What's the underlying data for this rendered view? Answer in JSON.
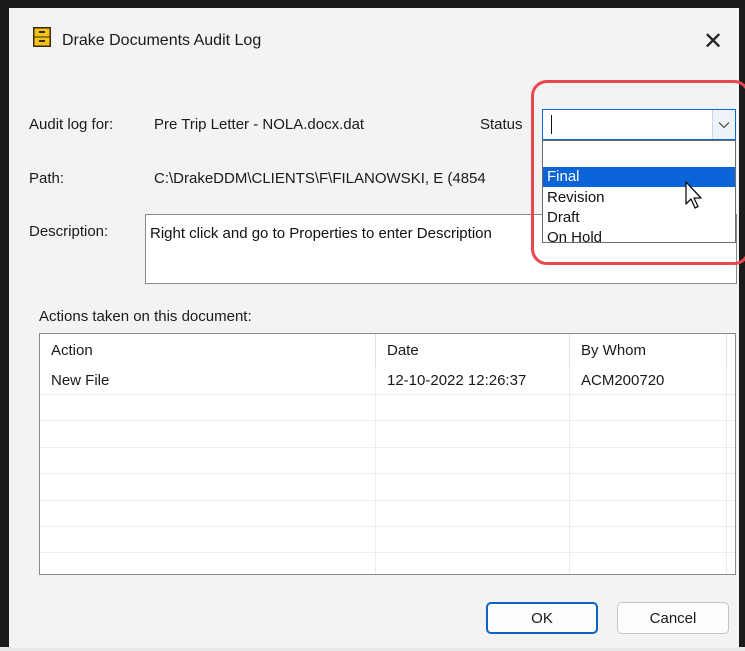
{
  "window": {
    "title": "Drake Documents Audit Log",
    "close_glyph": "✕"
  },
  "form": {
    "audit_label": "Audit log for:",
    "audit_value": "Pre Trip Letter - NOLA.docx.dat",
    "status_label": "Status",
    "status_value": "",
    "path_label": "Path:",
    "path_value": "C:\\DrakeDDM\\CLIENTS\\F\\FILANOWSKI, E (4854",
    "description_label": "Description:",
    "description_value": "Right click and go to Properties to enter Description"
  },
  "status_dropdown": {
    "options": [
      "",
      "Final",
      "Revision",
      "Draft",
      "On Hold"
    ],
    "highlighted": "Final"
  },
  "actions": {
    "label": "Actions taken on this document:",
    "columns": [
      "Action",
      "Date",
      "By Whom"
    ],
    "rows": [
      [
        "New File",
        "12-10-2022 12:26:37",
        "ACM200720"
      ]
    ]
  },
  "buttons": {
    "ok": "OK",
    "cancel": "Cancel"
  },
  "colors": {
    "accent": "#0a64d8",
    "highlight_ring": "#e8474f"
  }
}
